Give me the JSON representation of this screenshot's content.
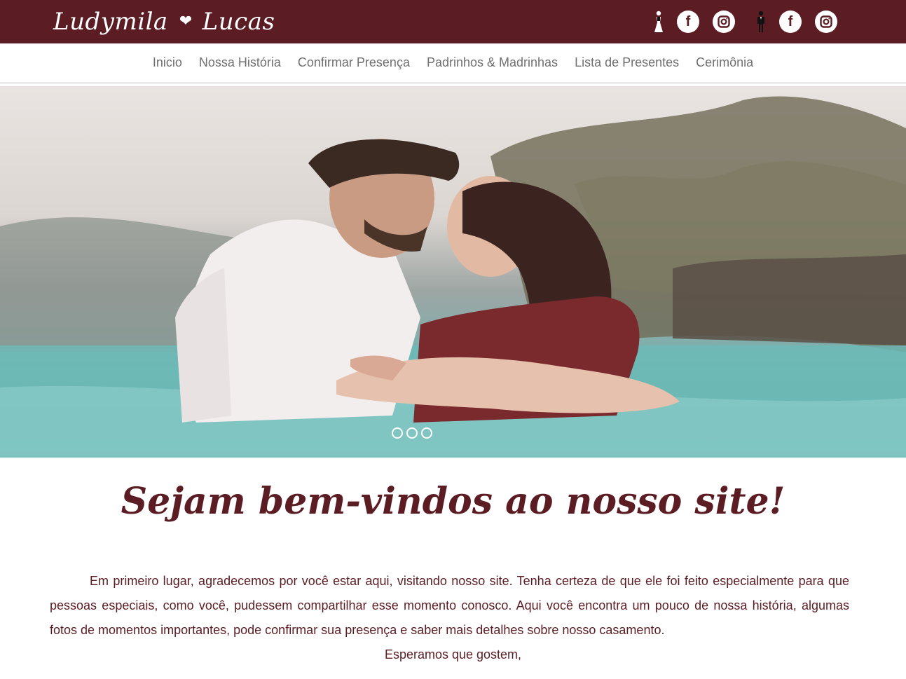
{
  "header": {
    "bride_name": "Ludymila",
    "groom_name": "Lucas",
    "heart_icon": "heart-icon",
    "bride_social": {
      "figure_icon": "bride-icon",
      "facebook_label": "f",
      "instagram_icon": "instagram-icon"
    },
    "groom_social": {
      "figure_icon": "groom-icon",
      "facebook_label": "f",
      "instagram_icon": "instagram-icon"
    }
  },
  "nav": {
    "items": [
      "Inicio",
      "Nossa História",
      "Confirmar Presença",
      "Padrinhos & Madrinhas",
      "Lista de Presentes",
      "Cerimônia"
    ]
  },
  "hero": {
    "slide_count": 3,
    "image_description_icon": "couple-photo"
  },
  "welcome": {
    "title": "Sejam bem-vindos ao nosso site!",
    "paragraph": "Em primeiro lugar, agradecemos por você estar aqui, visitando nosso site. Tenha certeza de que ele foi feito especialmente para que pessoas especiais, como você, pudessem compartilhar esse momento conosco. Aqui você encontra um pouco de nossa história, algumas fotos de momentos importantes, pode confirmar sua presença e saber mais detalhes sobre nosso casamento.",
    "closing": "Esperamos que gostem,"
  },
  "colors": {
    "brand": "#5b1d23",
    "nav_text": "#707070",
    "background": "#ffffff"
  }
}
